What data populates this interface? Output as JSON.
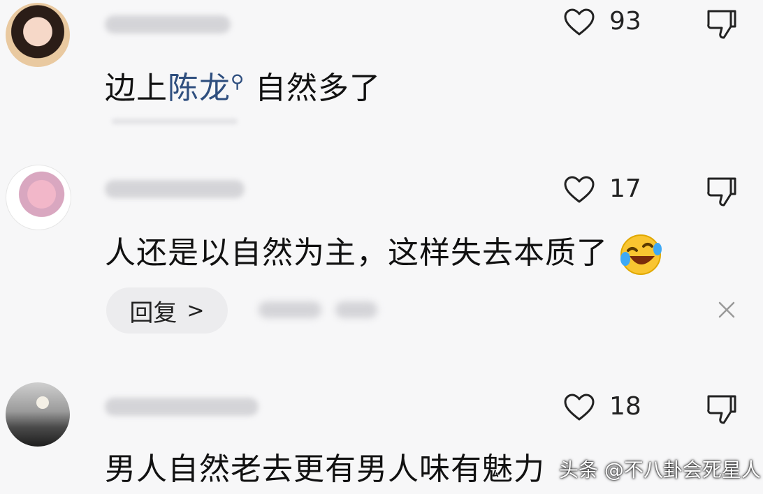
{
  "comments": [
    {
      "likes": "93",
      "text_prefix": "边上",
      "mention": "陈龙",
      "text_suffix": "自然多了"
    },
    {
      "likes": "17",
      "text": "人还是以自然为主，这样失去本质了",
      "reply_label": "回复",
      "reply_chevron": ">"
    },
    {
      "likes": "18",
      "text": "男人自然老去更有男人味有魅力"
    }
  ],
  "watermark": "头条 @不八卦会死星人",
  "icons": {
    "like": "heart-outline-icon",
    "dislike": "thumbs-down-icon",
    "close": "close-icon",
    "emoji": "rolling-on-floor-laughing-icon"
  },
  "colors": {
    "background": "#f7f7f8",
    "mention": "#2f4f7f",
    "text": "#111111"
  }
}
